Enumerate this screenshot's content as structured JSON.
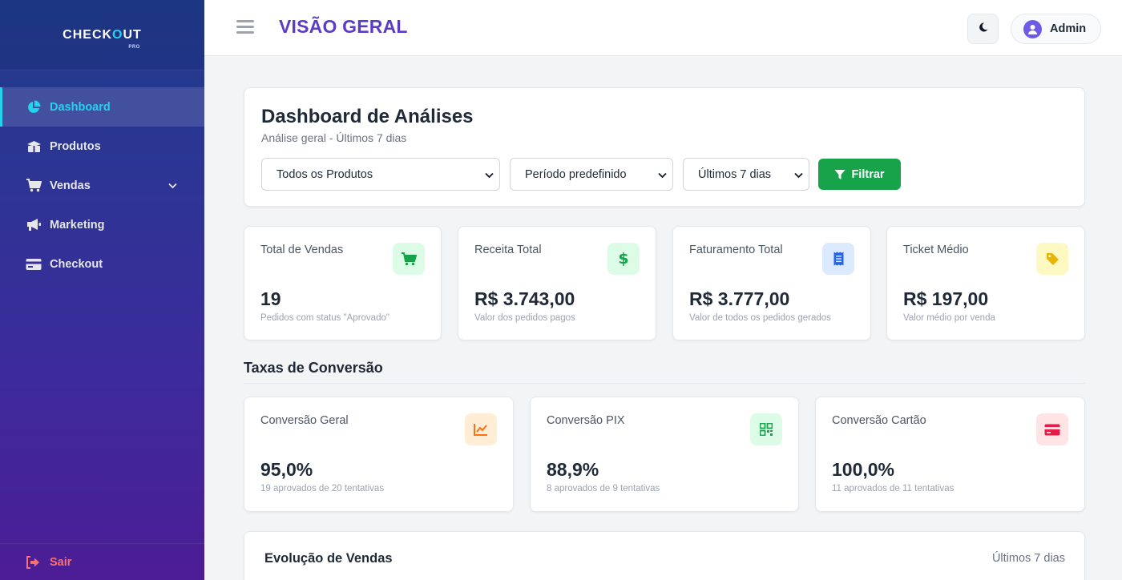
{
  "logo": {
    "pre": "CHECK",
    "o": "O",
    "post": "UT",
    "sub": "PRO"
  },
  "sidebar": {
    "items": [
      {
        "label": "Dashboard",
        "icon": "pie-chart-icon",
        "active": true
      },
      {
        "label": "Produtos",
        "icon": "boxes-icon"
      },
      {
        "label": "Vendas",
        "icon": "cart-icon",
        "has_submenu": true
      },
      {
        "label": "Marketing",
        "icon": "megaphone-icon"
      },
      {
        "label": "Checkout",
        "icon": "credit-card-icon"
      }
    ],
    "logout_label": "Sair"
  },
  "header": {
    "title": "VISÃO GERAL",
    "user": "Admin",
    "theme_icon": "moon-icon"
  },
  "filters": {
    "title": "Dashboard de Análises",
    "subtitle": "Análise geral - Últimos 7 dias",
    "product_select": "Todos os Produtos",
    "period_type_select": "Período predefinido",
    "period_select": "Últimos 7 dias",
    "filter_button": "Filtrar"
  },
  "stats": [
    {
      "label": "Total de Vendas",
      "value": "19",
      "desc": "Pedidos com status \"Aprovado\"",
      "icon": "cart-icon",
      "color": "#16a34a",
      "bg": "#dcfce7"
    },
    {
      "label": "Receita Total",
      "value": "R$ 3.743,00",
      "desc": "Valor dos pedidos pagos",
      "icon": "dollar-icon",
      "color": "#16a34a",
      "bg": "#dcfce7"
    },
    {
      "label": "Faturamento Total",
      "value": "R$ 3.777,00",
      "desc": "Valor de todos os pedidos gerados",
      "icon": "receipt-icon",
      "color": "#2563eb",
      "bg": "#dbeafe"
    },
    {
      "label": "Ticket Médio",
      "value": "R$ 197,00",
      "desc": "Valor médio por venda",
      "icon": "tag-icon",
      "color": "#eab308",
      "bg": "#fef9c3"
    }
  ],
  "conversion": {
    "title": "Taxas de Conversão",
    "items": [
      {
        "label": "Conversão Geral",
        "value": "95,0%",
        "desc": "19 aprovados de 20 tentativas",
        "icon": "line-chart-icon",
        "color": "#f97316",
        "bg": "#ffedd5"
      },
      {
        "label": "Conversão PIX",
        "value": "88,9%",
        "desc": "8 aprovados de 9 tentativas",
        "icon": "qrcode-icon",
        "color": "#16a34a",
        "bg": "#dcfce7"
      },
      {
        "label": "Conversão Cartão",
        "value": "100,0%",
        "desc": "11 aprovados de 11 tentativas",
        "icon": "credit-card-icon",
        "color": "#e11d48",
        "bg": "#ffe4e6"
      }
    ]
  },
  "evolution": {
    "title": "Evolução de Vendas",
    "period": "Últimos 7 dias"
  }
}
